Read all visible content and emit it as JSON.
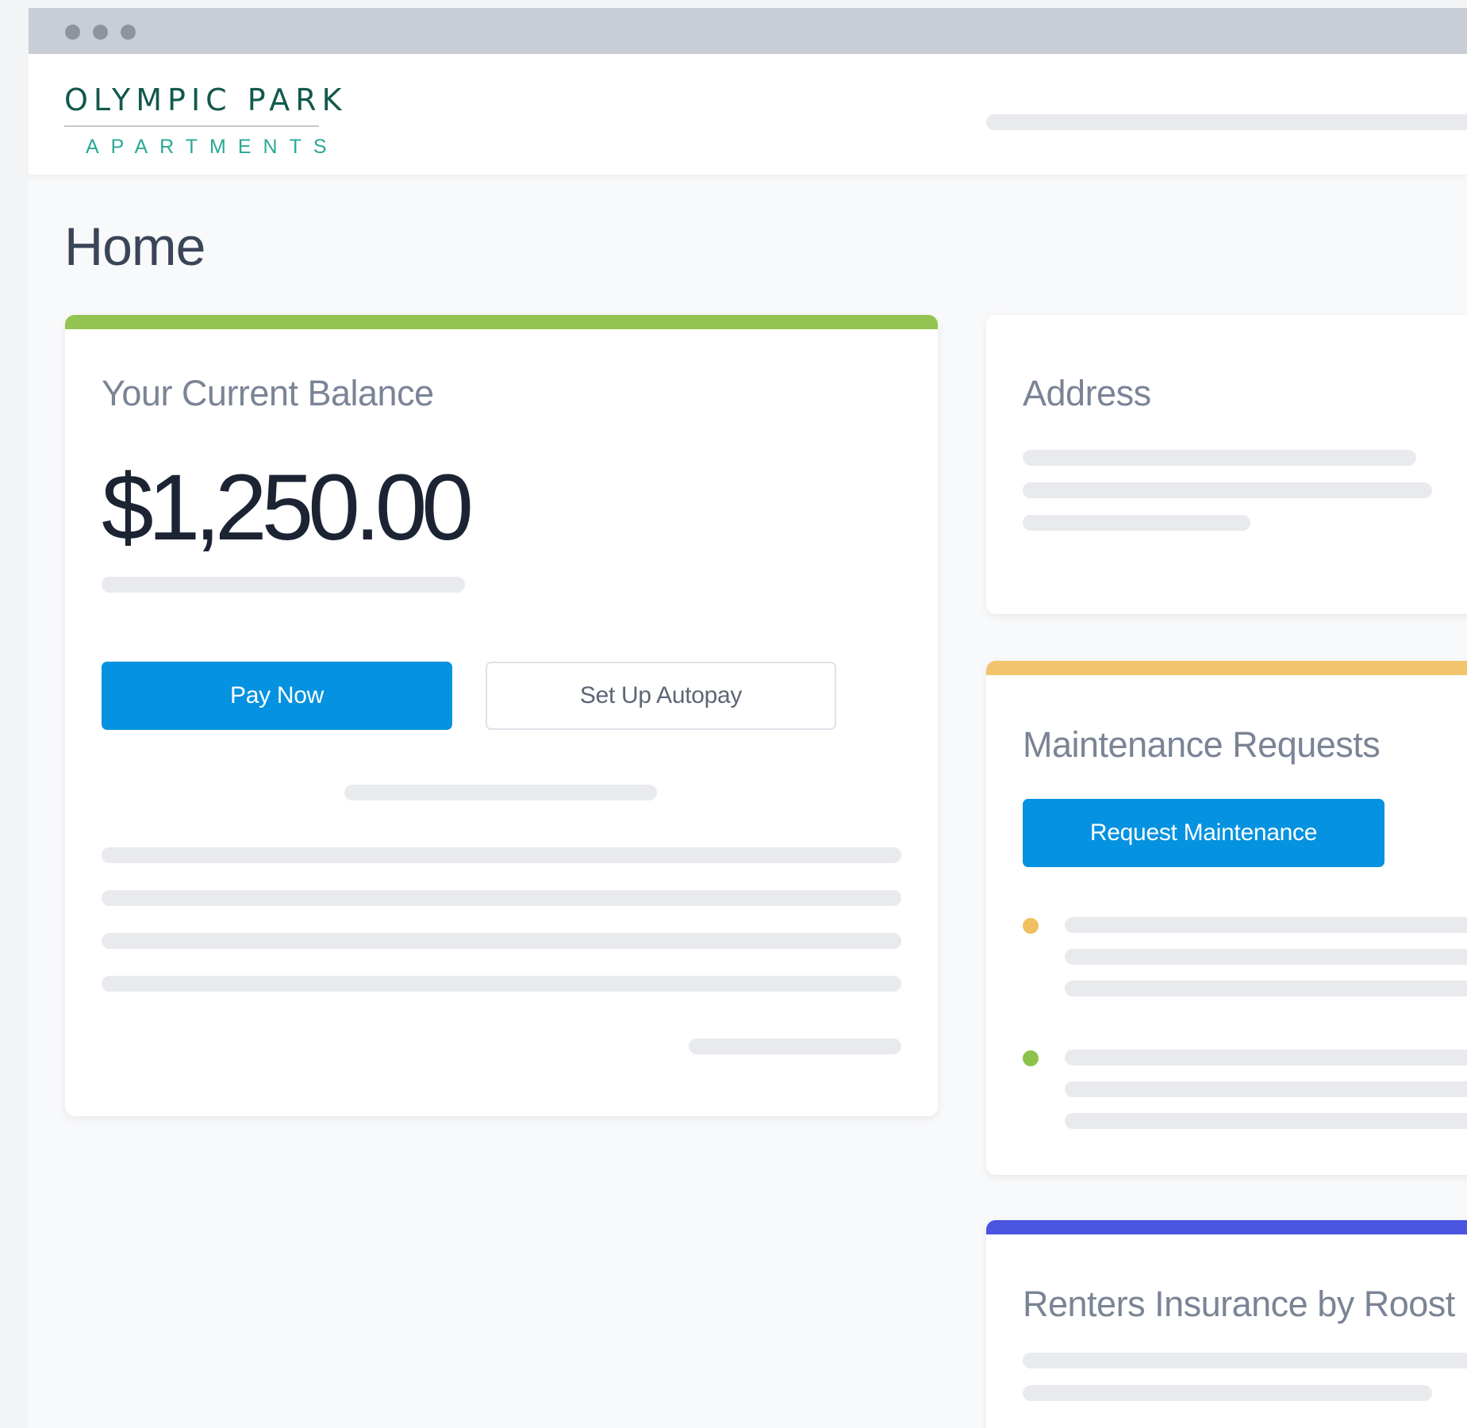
{
  "brand": {
    "name": "OLYMPIC PARK",
    "subtitle": "APARTMENTS",
    "primary_color": "#12594c",
    "accent_color": "#2aa896"
  },
  "page": {
    "title": "Home"
  },
  "balance_card": {
    "title": "Your Current Balance",
    "amount": "$1,250.00",
    "accent_color": "#93c350",
    "pay_button_label": "Pay Now",
    "autopay_button_label": "Set Up Autopay"
  },
  "address_card": {
    "title": "Address"
  },
  "maintenance_card": {
    "title": "Maintenance Requests",
    "accent_color": "#f2c46e",
    "request_button_label": "Request Maintenance",
    "requests": [
      {
        "status_color": "#f0c060"
      },
      {
        "status_color": "#8bc34a"
      }
    ]
  },
  "insurance_card": {
    "title": "Renters Insurance by Roost",
    "accent_color": "#4a55e0"
  },
  "window_controls": [
    "close-dot-icon",
    "minimize-dot-icon",
    "maximize-dot-icon"
  ]
}
